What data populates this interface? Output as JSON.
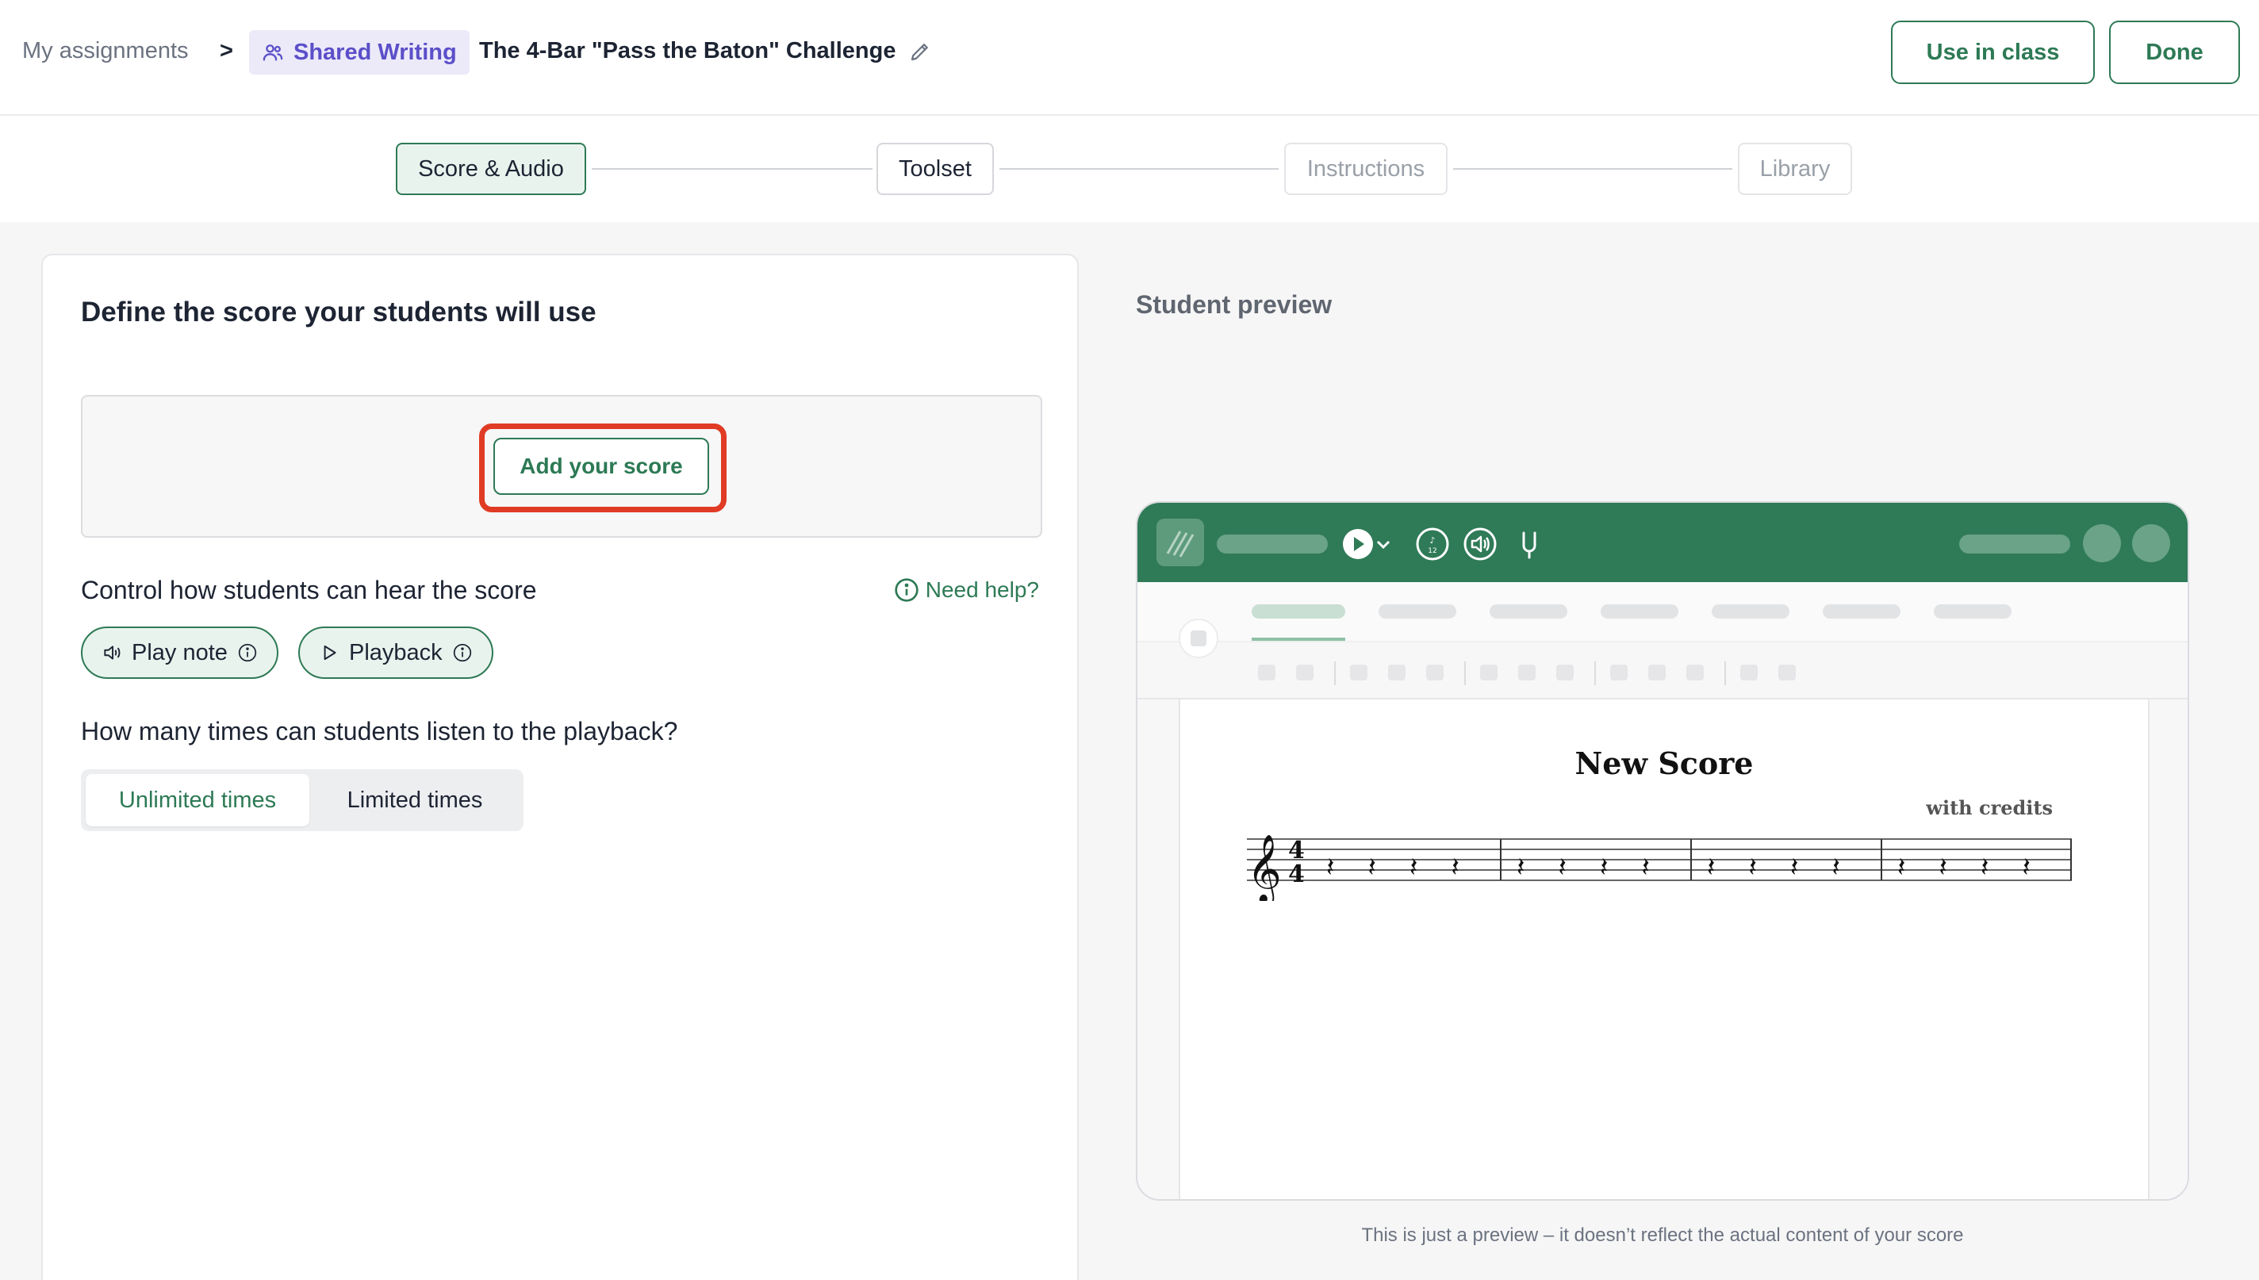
{
  "breadcrumb": {
    "root": "My assignments",
    "separator": ">",
    "type_tag": "Shared Writing",
    "assignment_title": "The 4-Bar \"Pass the Baton\" Challenge"
  },
  "actions": {
    "use_in_class": "Use in class",
    "done": "Done"
  },
  "steps": [
    {
      "label": "Score & Audio",
      "state": "active"
    },
    {
      "label": "Toolset",
      "state": "enabled"
    },
    {
      "label": "Instructions",
      "state": "disabled"
    },
    {
      "label": "Library",
      "state": "disabled"
    }
  ],
  "score_section": {
    "title": "Define the score your students will use",
    "add_score_label": "Add your score"
  },
  "hearing": {
    "heading": "Control how students can hear the score",
    "help_label": "Need help?",
    "options": [
      {
        "label": "Play note",
        "icon": "speaker-icon"
      },
      {
        "label": "Playback",
        "icon": "play-icon"
      }
    ]
  },
  "listen": {
    "heading": "How many times can students listen to the playback?",
    "options": [
      "Unlimited times",
      "Limited times"
    ],
    "selected": "Unlimited times"
  },
  "preview": {
    "label": "Student preview",
    "score_title": "New Score",
    "score_credits": "with credits",
    "time_signature": "4/4",
    "measures": 4,
    "note": "This is just a preview – it doesn’t reflect the actual content of your score"
  },
  "colors": {
    "accent": "#2d7a55",
    "tag": "#5b4fc9",
    "highlight": "#e03b24"
  }
}
